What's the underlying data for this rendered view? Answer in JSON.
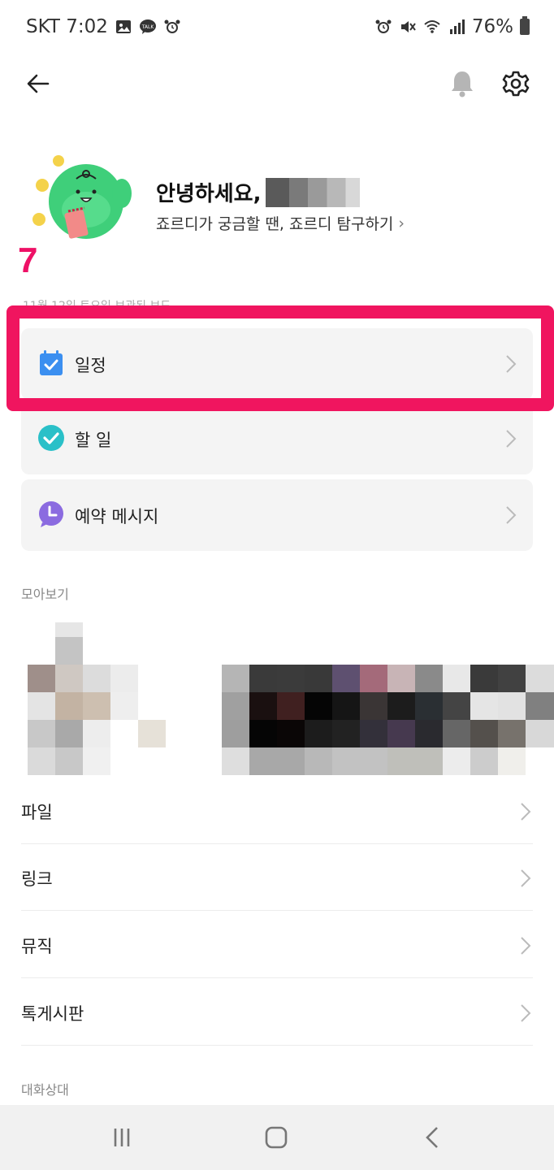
{
  "status_bar": {
    "carrier_time": "SKT 7:02",
    "battery": "76%",
    "icons_left": [
      "image-icon",
      "talk-icon",
      "alarm-icon"
    ],
    "icons_right": [
      "alarm-icon",
      "mute-icon",
      "wifi-icon",
      "signal-icon",
      "battery-icon"
    ]
  },
  "header": {
    "back_icon": "arrow-left-icon",
    "bell_icon": "bell-icon",
    "settings_icon": "gear-icon"
  },
  "profile": {
    "greeting": "안녕하세요,",
    "subtitle": "죠르디가 궁금할 땐, 죠르디 탐구하기",
    "subtitle_chevron": "›"
  },
  "annotation": {
    "step_number": "7",
    "highlight_color": "#f0155f"
  },
  "date_label": "11월 12일 토요일 보관된 보드",
  "cards": [
    {
      "label": "일정",
      "icon": "calendar-check-icon",
      "icon_color": "#3b8ff0"
    },
    {
      "label": "할 일",
      "icon": "check-circle-icon",
      "icon_color": "#2ac0c8"
    },
    {
      "label": "예약 메시지",
      "icon": "clock-bubble-icon",
      "icon_color": "#8b6be0"
    }
  ],
  "gallery_label": "모아보기",
  "list": [
    {
      "label": "파일"
    },
    {
      "label": "링크"
    },
    {
      "label": "뮤직"
    },
    {
      "label": "톡게시판"
    }
  ],
  "contacts_label": "대화상대",
  "nav": {
    "recents_icon": "recents-icon",
    "home_icon": "home-icon",
    "back_icon": "nav-back-icon"
  }
}
